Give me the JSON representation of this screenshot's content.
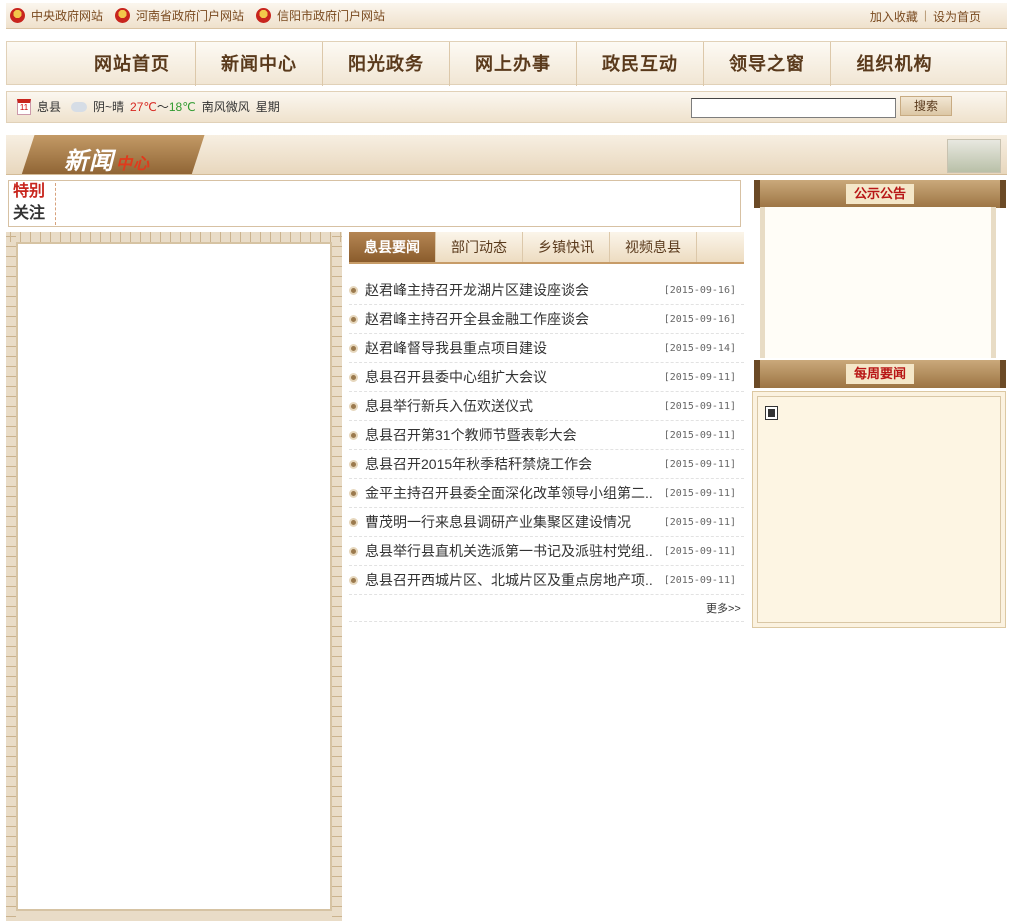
{
  "top_links": [
    {
      "label": "中央政府网站"
    },
    {
      "label": "河南省政府门户网站"
    },
    {
      "label": "信阳市政府门户网站"
    }
  ],
  "top_right": {
    "bookmark": "加入收藏",
    "separator": "|",
    "homepage": "设为首页"
  },
  "nav": {
    "items": [
      "网站首页",
      "新闻中心",
      "阳光政务",
      "网上办事",
      "政民互动",
      "领导之窗",
      "组织机构"
    ]
  },
  "weather": {
    "calendar_text": "11",
    "city": "息县",
    "condition": "阴~晴",
    "temp_high": "27℃",
    "temp_sep": "～",
    "temp_low": "18℃",
    "wind": "南风微风",
    "weekday_partial": "星期"
  },
  "search": {
    "button": "搜索",
    "value": ""
  },
  "banner": {
    "title": "新闻",
    "subtitle": "中心"
  },
  "special": {
    "label_line1": "特别",
    "label_line2": "关注"
  },
  "tabs": [
    {
      "label": "息县要闻",
      "active": true
    },
    {
      "label": "部门动态",
      "active": false
    },
    {
      "label": "乡镇快讯",
      "active": false
    },
    {
      "label": "视频息县",
      "active": false
    }
  ],
  "news": [
    {
      "title": "赵君峰主持召开龙湖片区建设座谈会",
      "date": "[2015-09-16]"
    },
    {
      "title": "赵君峰主持召开全县金融工作座谈会",
      "date": "[2015-09-16]"
    },
    {
      "title": "赵君峰督导我县重点项目建设",
      "date": "[2015-09-14]"
    },
    {
      "title": "息县召开县委中心组扩大会议",
      "date": "[2015-09-11]"
    },
    {
      "title": "息县举行新兵入伍欢送仪式",
      "date": "[2015-09-11]"
    },
    {
      "title": "息县召开第31个教师节暨表彰大会",
      "date": "[2015-09-11]"
    },
    {
      "title": "息县召开2015年秋季秸秆禁烧工作会",
      "date": "[2015-09-11]"
    },
    {
      "title": "金平主持召开县委全面深化改革领导小组第二..",
      "date": "[2015-09-11]"
    },
    {
      "title": "曹茂明一行来息县调研产业集聚区建设情况",
      "date": "[2015-09-11]"
    },
    {
      "title": "息县举行县直机关选派第一书记及派驻村党组..",
      "date": "[2015-09-11]"
    },
    {
      "title": "息县召开西城片区、北城片区及重点房地产项..",
      "date": "[2015-09-11]"
    }
  ],
  "more": "更多>>",
  "right": {
    "notice_title": "公示公告",
    "weekly_title": "每周要闻"
  },
  "colors": {
    "brand_brown": "#8a5c2c",
    "accent_red": "#c8251d",
    "temp_high": "#d7261f",
    "temp_low": "#2f9a2f"
  }
}
